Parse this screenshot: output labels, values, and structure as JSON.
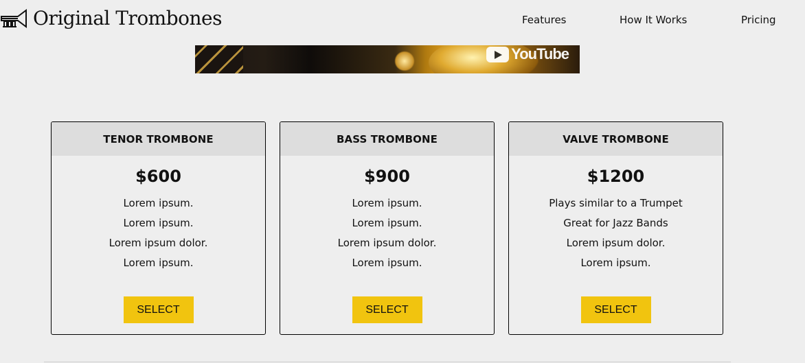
{
  "header": {
    "brand": "Original Trombones",
    "logo_icon": "trumpet-icon",
    "nav": [
      {
        "label": "Features"
      },
      {
        "label": "How It Works"
      },
      {
        "label": "Pricing"
      }
    ]
  },
  "video": {
    "platform": "YouTube",
    "play_icon": "youtube-play-icon"
  },
  "products": [
    {
      "name": "TENOR TROMBONE",
      "price": "$600",
      "features": [
        "Lorem ipsum.",
        "Lorem ipsum.",
        "Lorem ipsum dolor.",
        "Lorem ipsum."
      ],
      "button": "SELECT"
    },
    {
      "name": "BASS TROMBONE",
      "price": "$900",
      "features": [
        "Lorem ipsum.",
        "Lorem ipsum.",
        "Lorem ipsum dolor.",
        "Lorem ipsum."
      ],
      "button": "SELECT"
    },
    {
      "name": "VALVE TROMBONE",
      "price": "$1200",
      "features": [
        "Plays similar to a Trumpet",
        "Great for Jazz Bands",
        "Lorem ipsum dolor.",
        "Lorem ipsum."
      ],
      "button": "SELECT"
    }
  ],
  "colors": {
    "background": "#eeeeee",
    "card_header": "#dddddd",
    "button": "#f1c40f",
    "text": "#111111"
  }
}
